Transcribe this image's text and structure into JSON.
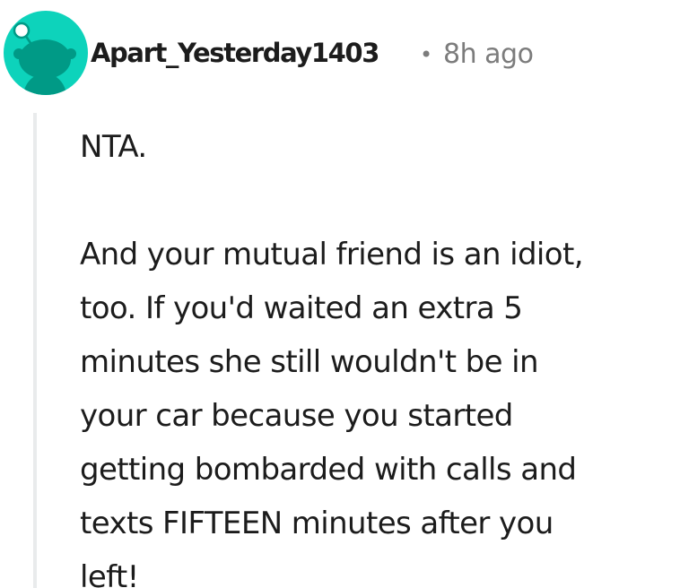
{
  "comment": {
    "author": "Apart_Yesterday1403",
    "separator": "•",
    "time": "8h ago",
    "paragraphs": [
      [
        "NTA."
      ],
      [
        "And your mutual friend is an idiot,",
        "too. If you'd waited an extra 5",
        "minutes she still wouldn't be in",
        "your car because you started",
        "getting bombarded with calls and",
        "texts FIFTEEN minutes after you",
        "left!"
      ]
    ]
  },
  "colors": {
    "avatar_bg": "#0dd3bb",
    "text": "#1c1c1c",
    "meta": "#7c7c7c",
    "thread_line": "#e9ebec"
  },
  "icons": {
    "avatar": "reddit-snoo-avatar-icon"
  }
}
